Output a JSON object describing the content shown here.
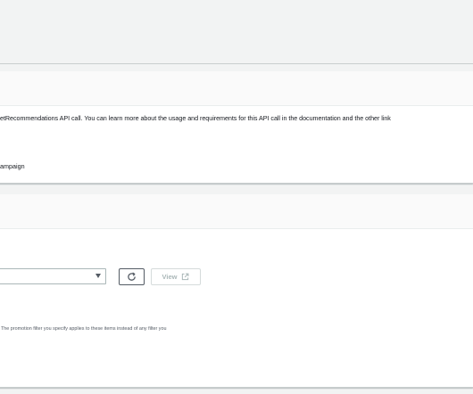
{
  "panel_1": {
    "description": "etRecommendations API call. You can learn more about the usage and requirements for this API call in the documentation and the other link",
    "radio_label": "ampaign"
  },
  "panel_2": {
    "view_button_label": "View",
    "promotion_hint": "The promotion filter you specify applies to these items instead of any filter you"
  },
  "icons": {
    "refresh": "refresh-icon",
    "external_link": "external-link-icon",
    "dropdown": "caret-down-icon"
  },
  "colors": {
    "page_background": "#f2f3f3",
    "panel_background": "#ffffff",
    "panel_header": "#fafafa",
    "disabled_text": "#aab7b8",
    "border": "#545b64"
  }
}
